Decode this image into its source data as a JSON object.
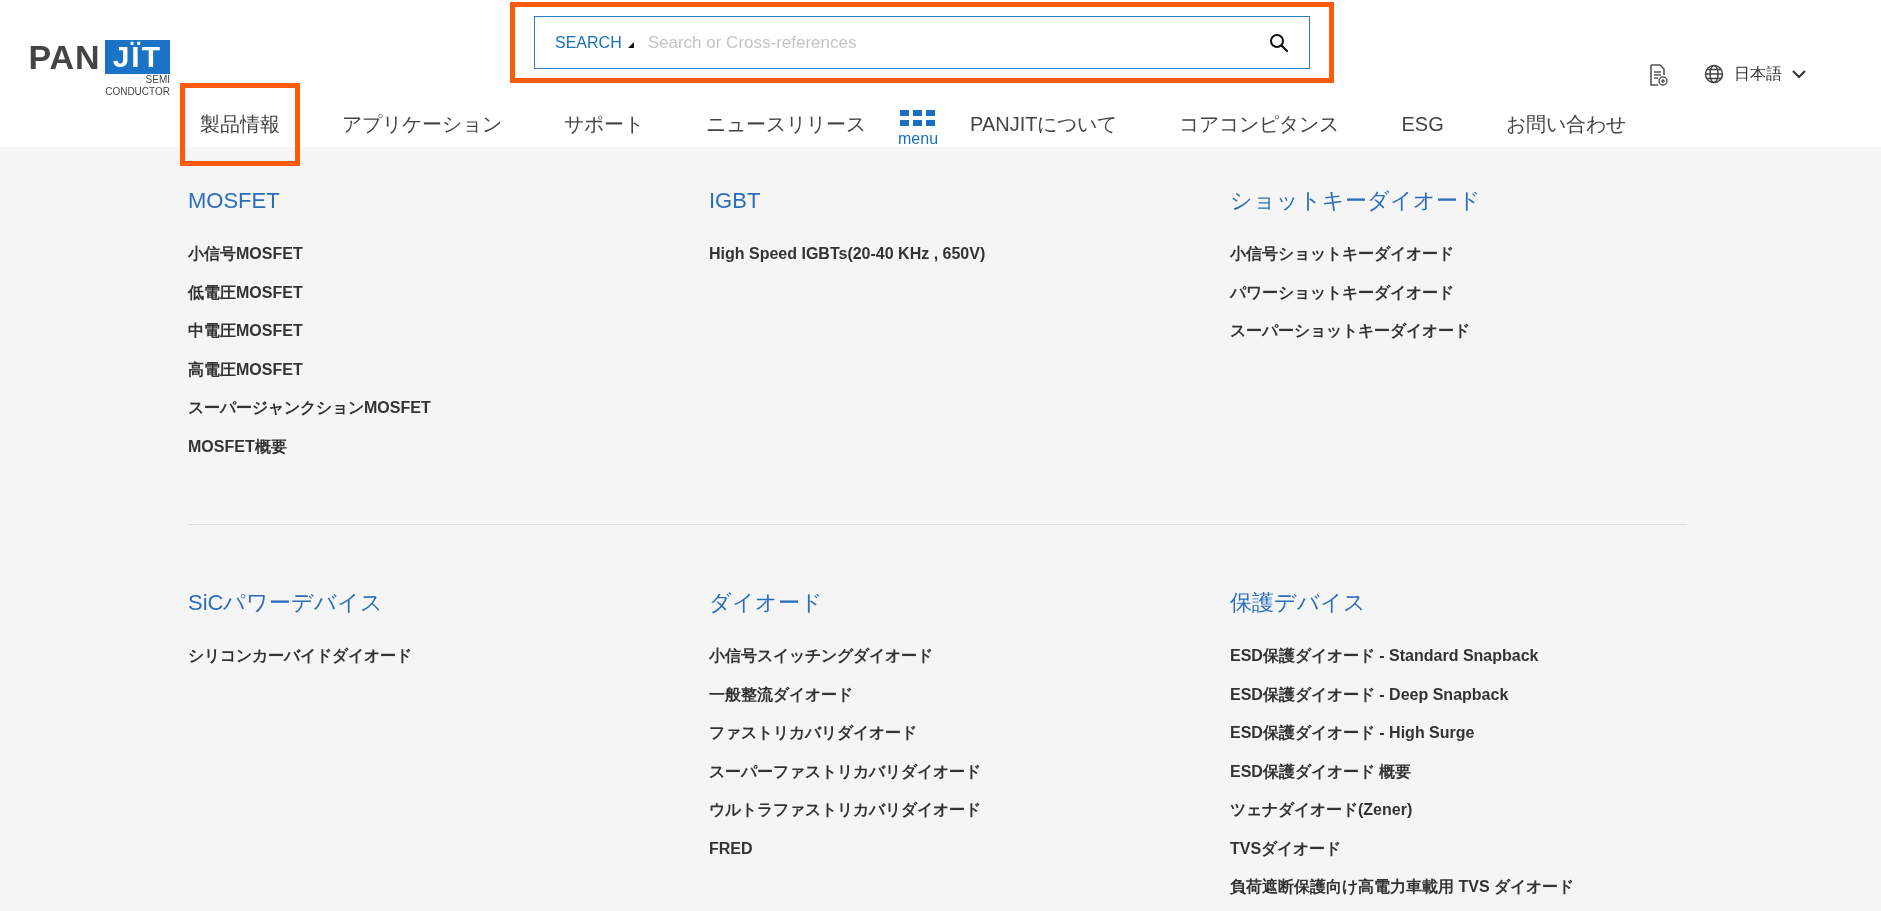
{
  "logo": {
    "wordmark_left": "PAN",
    "wordmark_right": "JÏT",
    "tagline_1": "SEMI",
    "tagline_2": "CONDUCTOR"
  },
  "search": {
    "highlighted": true,
    "scope": "SEARCH",
    "placeholder": "Search or Cross-references"
  },
  "nav": [
    {
      "label": "製品情報",
      "kind": "link",
      "highlighted": true
    },
    {
      "label": "アプリケーション",
      "kind": "link",
      "highlighted": false
    },
    {
      "label": "サポート",
      "kind": "link",
      "highlighted": false
    },
    {
      "label": "ニュースリリース",
      "kind": "link",
      "highlighted": false
    },
    {
      "label": "menu",
      "kind": "menu",
      "highlighted": false
    },
    {
      "label": "PANJITについて",
      "kind": "link",
      "highlighted": false
    },
    {
      "label": "コアコンピタンス",
      "kind": "link",
      "highlighted": false
    },
    {
      "label": "ESG",
      "kind": "link",
      "highlighted": false
    },
    {
      "label": "お問い合わせ",
      "kind": "link",
      "highlighted": false
    }
  ],
  "language": {
    "label": "日本語"
  },
  "mega_menu": [
    [
      {
        "heading": "MOSFET",
        "items": [
          "小信号MOSFET",
          "低電圧MOSFET",
          "中電圧MOSFET",
          "高電圧MOSFET",
          "スーパージャンクションMOSFET",
          "MOSFET概要"
        ]
      },
      {
        "heading": "IGBT",
        "items": [
          "High Speed IGBTs(20-40 KHz , 650V)"
        ]
      },
      {
        "heading": "ショットキーダイオード",
        "items": [
          "小信号ショットキーダイオード",
          "パワーショットキーダイオード",
          "スーパーショットキーダイオード"
        ]
      }
    ],
    [
      {
        "heading": "SiCパワーデバイス",
        "items": [
          "シリコンカーバイドダイオード"
        ]
      },
      {
        "heading": "ダイオード",
        "items": [
          "小信号スイッチングダイオード",
          "一般整流ダイオード",
          "ファストリカバリダイオード",
          "スーパーファストリカバリダイオード",
          "ウルトラファストリカバリダイオード",
          "FRED"
        ]
      },
      {
        "heading": "保護デバイス",
        "items": [
          "ESD保護ダイオード - Standard Snapback",
          "ESD保護ダイオード - Deep Snapback",
          "ESD保護ダイオード - High Surge",
          "ESD保護ダイオード 概要",
          "ツェナダイオード(Zener)",
          "TVSダイオード",
          "負荷遮断保護向け高電力車載用 TVS ダイオード"
        ]
      }
    ]
  ]
}
